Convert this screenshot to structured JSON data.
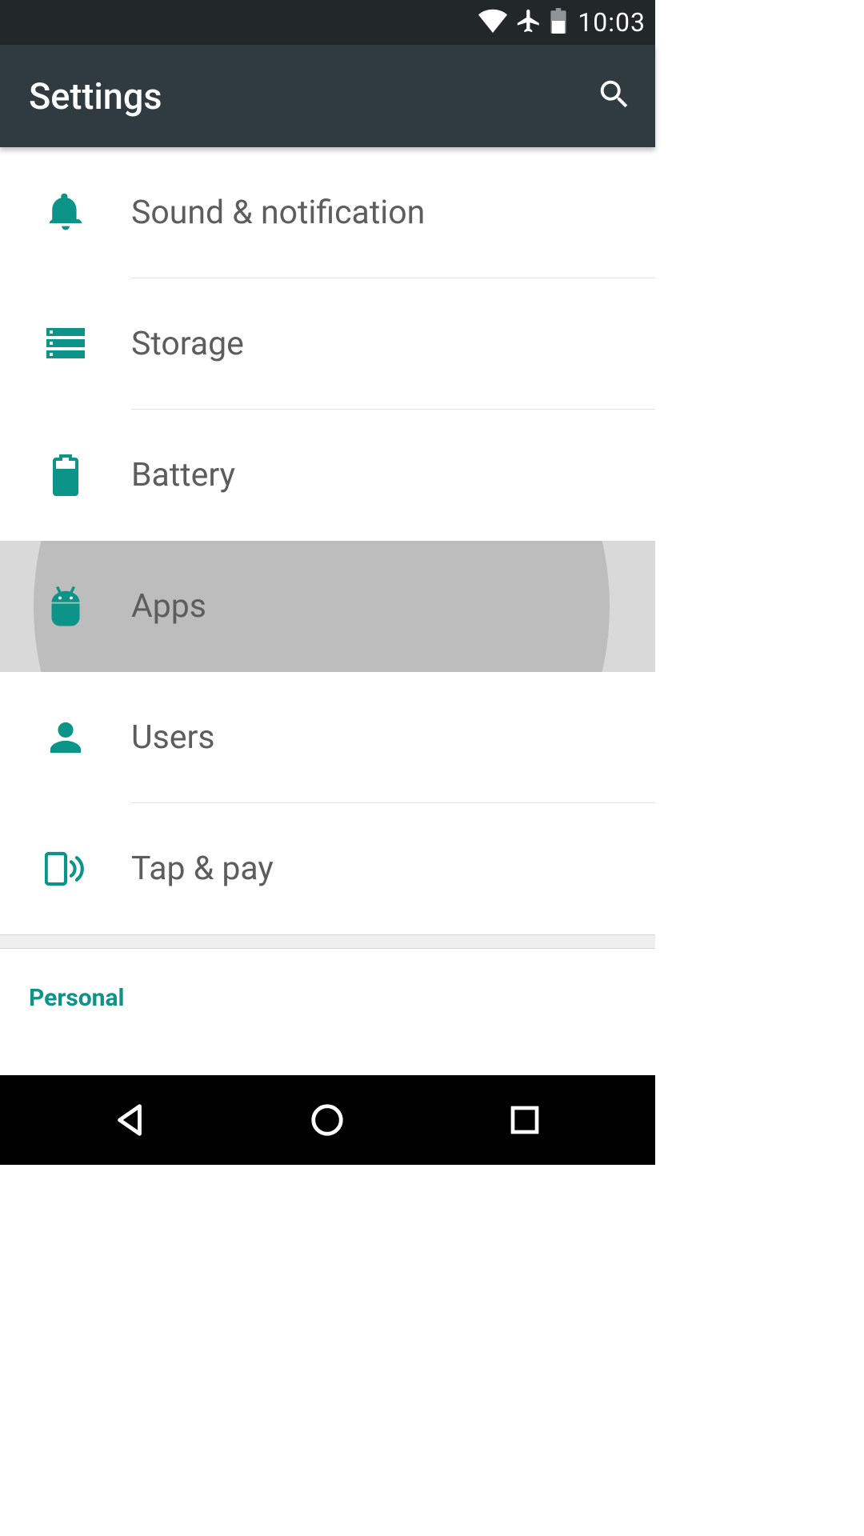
{
  "status": {
    "time": "10:03"
  },
  "header": {
    "title": "Settings"
  },
  "items": {
    "sound": {
      "label": "Sound & notification"
    },
    "storage": {
      "label": "Storage"
    },
    "battery": {
      "label": "Battery"
    },
    "apps": {
      "label": "Apps"
    },
    "users": {
      "label": "Users"
    },
    "tappay": {
      "label": "Tap & pay"
    }
  },
  "section": {
    "personal": "Personal"
  },
  "colors": {
    "accent": "#0d9488",
    "appbar": "#2f3b40",
    "statusbar": "#22272a"
  }
}
